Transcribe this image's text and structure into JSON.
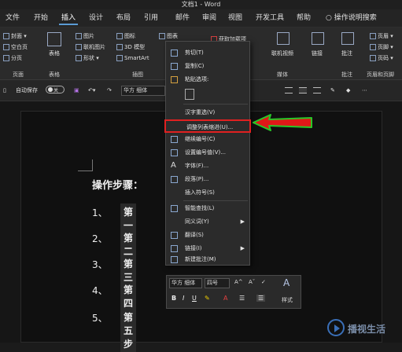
{
  "window": {
    "title": "文档1 - Word"
  },
  "menu": {
    "tabs": [
      {
        "label": "文件"
      },
      {
        "label": "开始"
      },
      {
        "label": "插入"
      },
      {
        "label": "设计"
      },
      {
        "label": "布局"
      },
      {
        "label": "引用"
      },
      {
        "label": "邮件"
      },
      {
        "label": "审阅"
      },
      {
        "label": "视图"
      },
      {
        "label": "开发工具"
      },
      {
        "label": "帮助"
      }
    ],
    "active_tab": "插入",
    "search": "操作说明搜索"
  },
  "ribbon": {
    "pages": {
      "cover": "封面",
      "blank": "空白页",
      "break": "分页",
      "group": "页面"
    },
    "table": {
      "label": "表格",
      "group": "表格"
    },
    "illustrations": {
      "pictures": "图片",
      "online_pictures": "联机图片",
      "shapes": "形状",
      "icons": "图标",
      "models": "3D 模型",
      "smartart": "SmartArt",
      "chart": "图表",
      "group": "插图"
    },
    "addins": {
      "get": "获取加载项"
    },
    "media": {
      "online_video": "联机视频",
      "group": "媒体"
    },
    "links": {
      "label": "链接"
    },
    "comments": {
      "label": "批注",
      "group": "批注"
    },
    "header_footer": {
      "header": "页眉",
      "footer": "页脚",
      "page_number": "页码",
      "group": "页眉和页脚"
    }
  },
  "qat": {
    "autosave_label": "自动保存",
    "autosave_state": "关",
    "font": "华方 细体"
  },
  "document": {
    "heading": "操作步骤：",
    "steps": [
      {
        "num": "1、",
        "text": "第一步"
      },
      {
        "num": "2、",
        "text": "第二步"
      },
      {
        "num": "3、",
        "text": "第三步"
      },
      {
        "num": "4、",
        "text": "第四步"
      },
      {
        "num": "5、",
        "text": "第五步"
      }
    ]
  },
  "context_menu": {
    "cut": "剪切(T)",
    "copy": "复制(C)",
    "paste_options": "粘贴选项:",
    "hanzi": "汉字重选(V)",
    "adjust_indent": "调整列表缩进(U)...",
    "continue_numbering": "继续编号(C)",
    "set_numbering_value": "设置编号值(V)...",
    "font": "字体(F)...",
    "paragraph": "段落(P)...",
    "insert_symbol": "插入符号(S)",
    "smart_lookup": "智能查找(L)",
    "synonyms": "同义词(Y)",
    "translate": "翻译(S)",
    "link": "链接(I)",
    "new_comment": "新建批注(M)"
  },
  "mini_toolbar": {
    "font": "华方 细体",
    "size": "四号",
    "style_label": "样式",
    "bold": "B",
    "italic": "I",
    "underline": "U"
  },
  "watermark": {
    "text": "播视生活"
  },
  "colors": {
    "highlight_border": "#e02020",
    "arrow_fill": "#e01818",
    "arrow_stroke": "#28c828"
  }
}
